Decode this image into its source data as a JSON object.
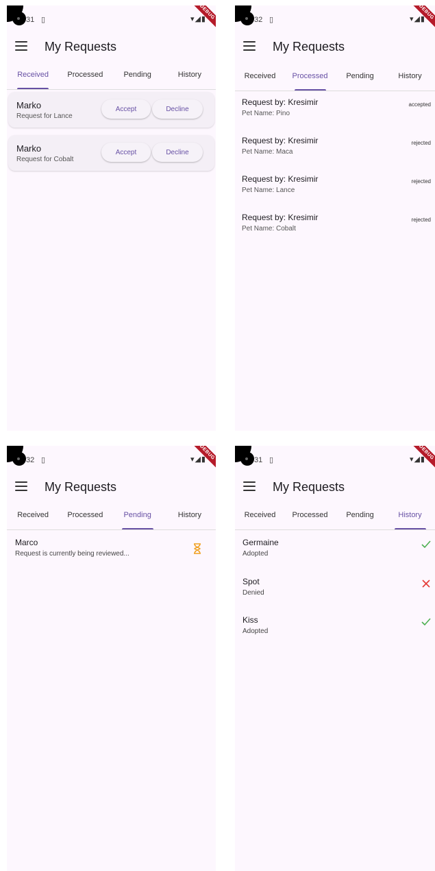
{
  "app_title": "My Requests",
  "tabs": [
    "Received",
    "Processed",
    "Pending",
    "History"
  ],
  "debug_label": "DEBUG",
  "screens": [
    {
      "time": "31",
      "active_tab": "Received",
      "received": [
        {
          "name": "Marko",
          "subtitle": "Request for Lance",
          "accept": "Accept",
          "decline": "Decline"
        },
        {
          "name": "Marko",
          "subtitle": "Request for Cobalt",
          "accept": "Accept",
          "decline": "Decline"
        }
      ]
    },
    {
      "time": "32",
      "active_tab": "Processed",
      "processed": [
        {
          "by": "Request by: Kresimir",
          "pet": "Pet Name: Pino",
          "status": "accepted"
        },
        {
          "by": "Request by: Kresimir",
          "pet": "Pet Name: Maca",
          "status": "rejected"
        },
        {
          "by": "Request by: Kresimir",
          "pet": "Pet Name: Lance",
          "status": "rejected"
        },
        {
          "by": "Request by: Kresimir",
          "pet": "Pet Name: Cobalt",
          "status": "rejected"
        }
      ]
    },
    {
      "time": "32",
      "active_tab": "Pending",
      "pending": {
        "name": "Marco",
        "subtitle": "Request is currently being reviewed...",
        "icon": "hourglass-icon"
      }
    },
    {
      "time": "31",
      "active_tab": "History",
      "history": [
        {
          "name": "Germaine",
          "status": "Adopted",
          "icon": "check-icon"
        },
        {
          "name": "Spot",
          "status": "Denied",
          "icon": "close-icon"
        },
        {
          "name": "Kiss",
          "status": "Adopted",
          "icon": "check-icon"
        }
      ]
    }
  ],
  "colors": {
    "accent": "#6750a4",
    "check": "#4caf50",
    "cross": "#e53935",
    "hourglass": "#f0a020",
    "ribbon": "#b51b2a"
  }
}
